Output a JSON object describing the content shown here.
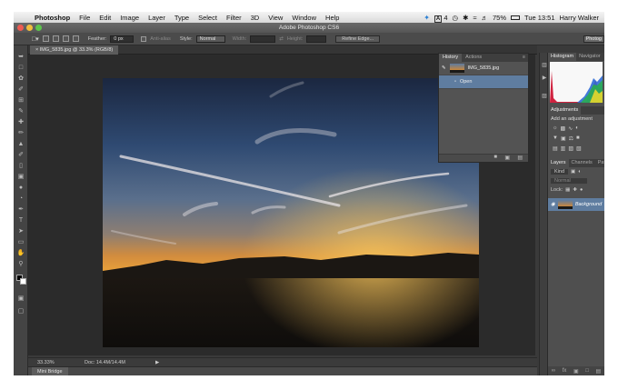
{
  "menubar": {
    "app": "Photoshop",
    "items": [
      "File",
      "Edit",
      "Image",
      "Layer",
      "Type",
      "Select",
      "Filter",
      "3D",
      "View",
      "Window",
      "Help"
    ],
    "status": {
      "badge": "4",
      "battery": "75%",
      "time": "Tue 13:51",
      "user": "Harry Walker"
    }
  },
  "window": {
    "title": "Adobe Photoshop CS6"
  },
  "options": {
    "feather_label": "Feather:",
    "feather_value": "0 px",
    "antialias_label": "Anti-alias",
    "style_label": "Style:",
    "style_value": "Normal",
    "width_label": "Width:",
    "height_label": "Height:",
    "refine_button": "Refine Edge...",
    "workspace": "Photog"
  },
  "document": {
    "tab": "IMG_5835.jpg @ 33.3% (RGB/8)",
    "zoom": "33.33%",
    "doc_size": "Doc: 14.4M/14.4M"
  },
  "mini_bridge": "Mini Bridge",
  "history_panel": {
    "tabs": [
      "History",
      "Actions"
    ],
    "snapshot": "IMG_5835.jpg",
    "steps": [
      "Open"
    ]
  },
  "right_panels": {
    "top_tabs": [
      "Histogram",
      "Navigator"
    ],
    "adjust_tab": "Adjustments",
    "adjust_title": "Add an adjustment",
    "layer_tabs": [
      "Layers",
      "Channels",
      "Paths"
    ],
    "kind": "Kind",
    "blend": "Normal",
    "lock_label": "Lock:",
    "layer_name": "Background"
  },
  "colors": {
    "selection": "#5f7da0",
    "panel": "#535353",
    "accent_twitter": "#2a7fd4"
  }
}
